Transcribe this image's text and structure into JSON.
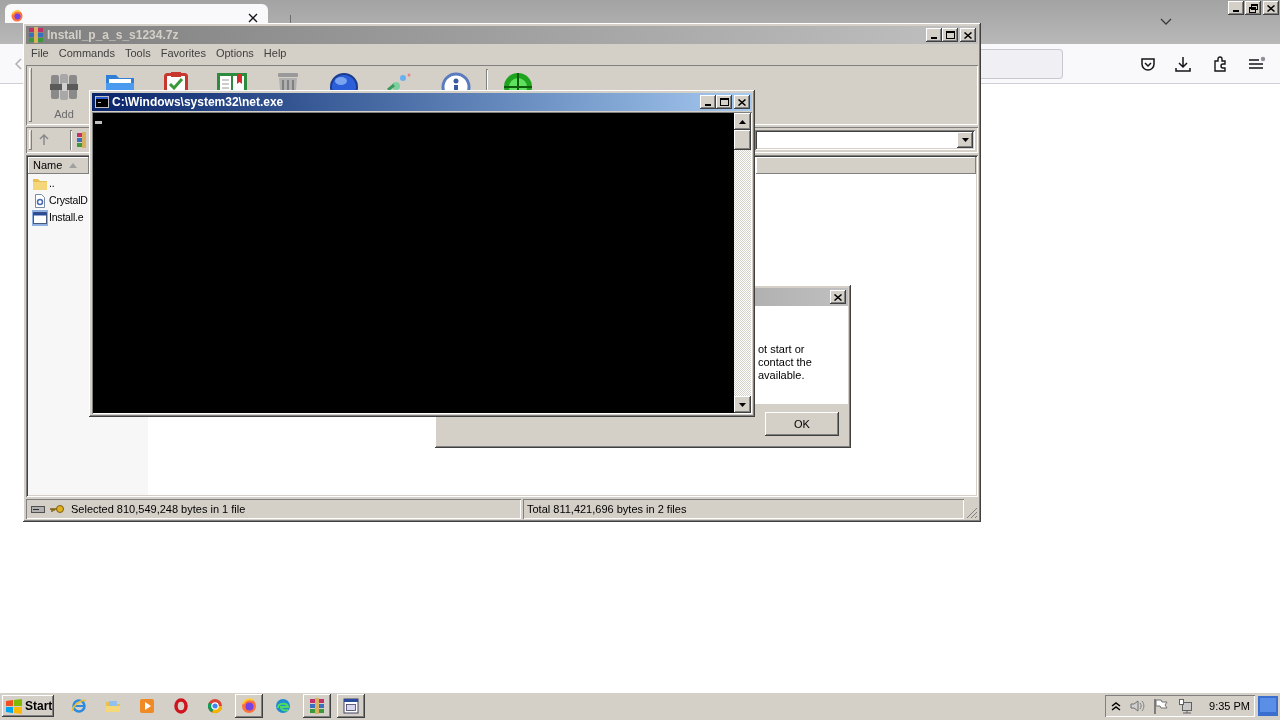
{
  "archive_window": {
    "active": false,
    "title": "Install_p_a_s_s1234.7z",
    "menu": [
      "File",
      "Commands",
      "Tools",
      "Favorites",
      "Options",
      "Help"
    ],
    "toolbar": [
      {
        "kind": "add",
        "label": "Add"
      },
      {
        "kind": "extract"
      },
      {
        "kind": "test"
      },
      {
        "kind": "view"
      },
      {
        "kind": "delete"
      },
      {
        "kind": "find"
      },
      {
        "kind": "wizard"
      },
      {
        "kind": "info"
      },
      {
        "kind": "separator"
      },
      {
        "kind": "scan"
      }
    ],
    "file_list": {
      "columns": [
        {
          "label": "Name",
          "sorted": true
        }
      ],
      "rows": [
        {
          "name": "..",
          "kind": "folder",
          "selected": false
        },
        {
          "name": "CrystalD",
          "kind": "settings",
          "selected": false
        },
        {
          "name": "Install.e",
          "kind": "program",
          "selected": true
        }
      ]
    },
    "status_bar": [
      "Selected 810,549,248 bytes in 1 file",
      "Total 811,421,696 bytes in 2 files"
    ]
  },
  "message_dialog": {
    "active": false,
    "lines": [
      "ot start or",
      "contact the",
      "available."
    ],
    "buttons": [
      "OK"
    ]
  },
  "console_window": {
    "active": true,
    "title": "C:\\Windows\\system32\\net.exe"
  },
  "taskbar": {
    "start_label": "Start",
    "apps": [
      {
        "kind": "ie",
        "open": false
      },
      {
        "kind": "explorer",
        "open": false
      },
      {
        "kind": "media",
        "open": false
      },
      {
        "kind": "opera",
        "open": false
      },
      {
        "kind": "chrome",
        "open": false
      },
      {
        "kind": "firefox",
        "open": true
      },
      {
        "kind": "edge",
        "open": false
      },
      {
        "kind": "archiver",
        "open": true
      },
      {
        "kind": "console",
        "open": true
      }
    ],
    "clock": "9:35 PM"
  }
}
